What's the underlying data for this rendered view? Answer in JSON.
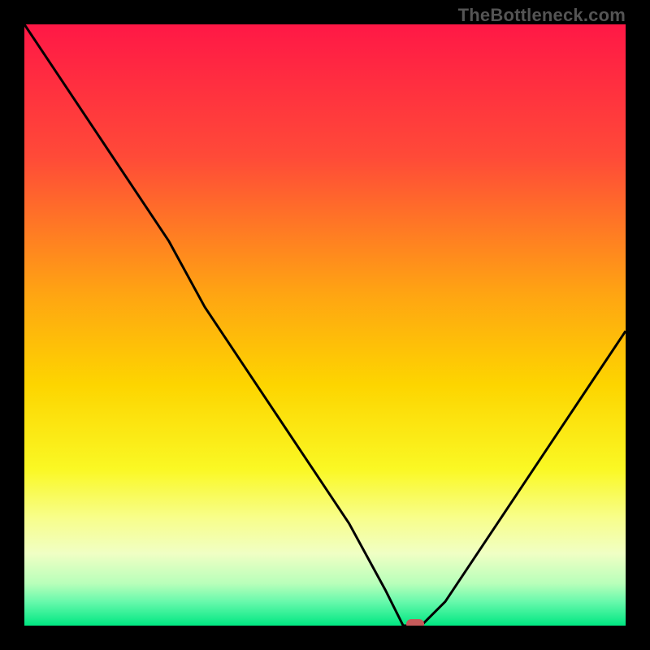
{
  "watermark": "TheBottleneck.com",
  "chart_data": {
    "type": "line",
    "title": "",
    "xlabel": "",
    "ylabel": "",
    "xlim": [
      0,
      100
    ],
    "ylim": [
      0,
      100
    ],
    "x": [
      0,
      6,
      12,
      18,
      24,
      30,
      36,
      42,
      48,
      54,
      60,
      63,
      66,
      70,
      76,
      82,
      88,
      94,
      100
    ],
    "values": [
      100,
      91,
      82,
      73,
      64,
      53,
      44,
      35,
      26,
      17,
      6,
      0,
      0,
      4,
      13,
      22,
      31,
      40,
      49
    ],
    "marker": {
      "x": 65,
      "y": 0
    },
    "background_gradient": {
      "stops": [
        {
          "offset": 0.0,
          "color": "#ff1846"
        },
        {
          "offset": 0.22,
          "color": "#ff4a38"
        },
        {
          "offset": 0.45,
          "color": "#ffa512"
        },
        {
          "offset": 0.6,
          "color": "#fdd500"
        },
        {
          "offset": 0.74,
          "color": "#faf824"
        },
        {
          "offset": 0.82,
          "color": "#f8fe8a"
        },
        {
          "offset": 0.88,
          "color": "#f0ffc4"
        },
        {
          "offset": 0.93,
          "color": "#b8ffba"
        },
        {
          "offset": 0.96,
          "color": "#68f9ac"
        },
        {
          "offset": 1.0,
          "color": "#00e782"
        }
      ]
    },
    "marker_color": "#c65a5a"
  }
}
